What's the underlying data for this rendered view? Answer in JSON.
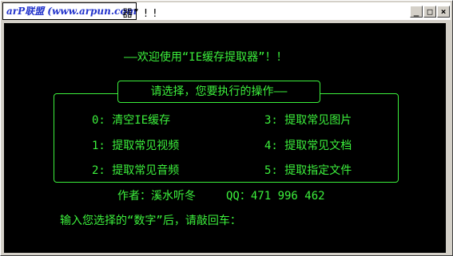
{
  "window": {
    "title_visible": "器” ! !",
    "watermark": "arP联盟 (www.arpun.com)",
    "minimize": "_",
    "maximize": "□",
    "close": "×"
  },
  "console": {
    "welcome": "——欢迎使用“IE缓存提取器”！！",
    "menu_title": "请选择，您要执行的操作——",
    "options": [
      {
        "key": "0:",
        "label": "清空IE缓存"
      },
      {
        "key": "1:",
        "label": "提取常见视频"
      },
      {
        "key": "2:",
        "label": "提取常见音频"
      },
      {
        "key": "3:",
        "label": "提取常见图片"
      },
      {
        "key": "4:",
        "label": "提取常见文档"
      },
      {
        "key": "5:",
        "label": "提取指定文件"
      }
    ],
    "author": "作者：溪水听冬",
    "qq": "QQ：471 996 462",
    "prompt": "输入您选择的“数字”后，请敲回车："
  },
  "colors": {
    "console_bg": "#000000",
    "console_fg": "#3cf03c"
  }
}
